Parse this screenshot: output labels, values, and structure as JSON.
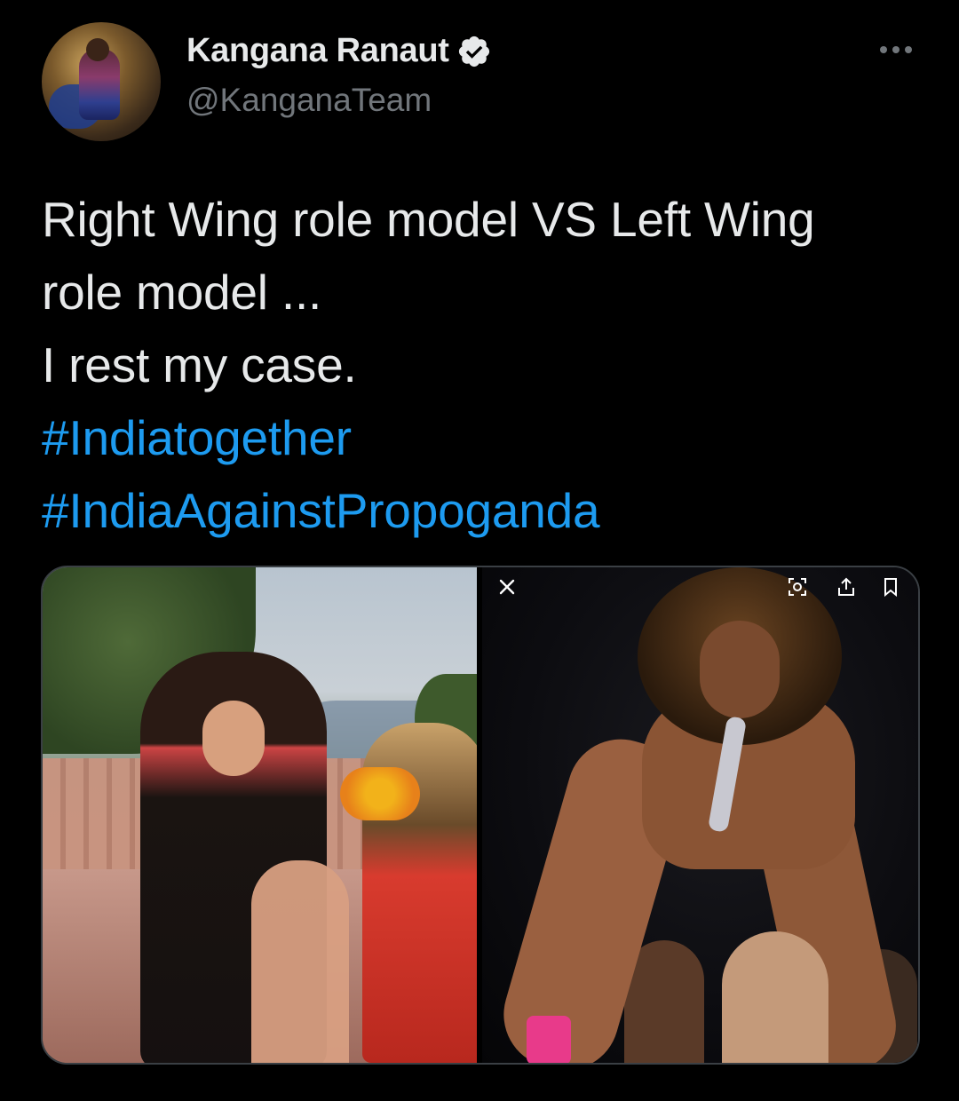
{
  "author": {
    "display_name": "Kangana Ranaut",
    "handle": "@KanganaTeam",
    "verified": true
  },
  "tweet": {
    "lines": [
      "Right Wing role model VS Left Wing",
      "role model ...",
      "I rest my case."
    ],
    "hashtags": [
      "#Indiatogether",
      "#IndiaAgainstPropoganda"
    ]
  },
  "media": {
    "count": 2,
    "overlay_icons": [
      "close-icon",
      "scan-icon",
      "share-icon",
      "bookmark-icon"
    ]
  },
  "colors": {
    "background": "#000000",
    "text": "#e7e9ea",
    "secondary": "#71767b",
    "accent": "#1d9bf0",
    "verified_badge": "#e7e9ea"
  }
}
